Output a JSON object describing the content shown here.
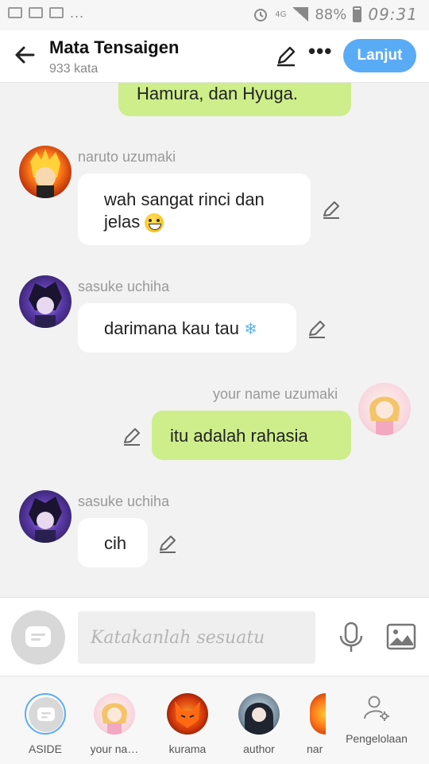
{
  "status_bar": {
    "network": "4G",
    "battery": "88%",
    "time": "09:31",
    "dots": "..."
  },
  "header": {
    "title": "Mata Tensaigen",
    "word_count": "933 kata",
    "next_label": "Lanjut",
    "icons": [
      "back-arrow-icon",
      "pencil-icon",
      "more-icon"
    ]
  },
  "messages": [
    {
      "sender": "",
      "side": "right",
      "text": "Hamura, dan Hyuga.",
      "color": "#cdee8a"
    },
    {
      "sender": "naruto uzumaki",
      "side": "left",
      "text_line1": "wah sangat rinci dan",
      "text_line2": "jelas",
      "emoji": "grinning-face-icon"
    },
    {
      "sender": "sasuke uchiha",
      "side": "left",
      "text": "darimana kau tau",
      "emoji": "snowflake-icon"
    },
    {
      "sender": "your name uzumaki",
      "side": "right",
      "text": "itu adalah rahasia"
    },
    {
      "sender": "sasuke uchiha",
      "side": "left",
      "text": "cih"
    }
  ],
  "input_bar": {
    "placeholder": "Katakanlah sesuatu"
  },
  "characters": [
    {
      "label": "ASIDE",
      "selected": true
    },
    {
      "label": "your na…",
      "selected": false
    },
    {
      "label": "kurama",
      "selected": false
    },
    {
      "label": "author",
      "selected": false
    },
    {
      "label": "nar",
      "selected": false
    }
  ],
  "manage_label": "Pengelolaan",
  "colors": {
    "accent": "#5aabf5",
    "green_bubble": "#cdee8a",
    "white_bubble": "#ffffff",
    "background": "#f2f2f2"
  }
}
